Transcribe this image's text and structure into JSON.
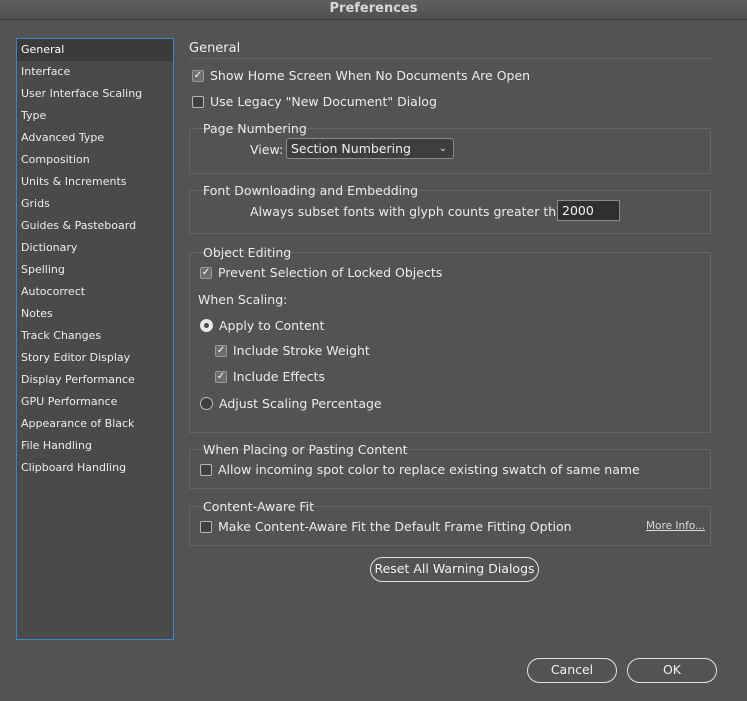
{
  "window": {
    "title": "Preferences"
  },
  "sidebar": {
    "items": [
      {
        "label": "General",
        "selected": true
      },
      {
        "label": "Interface"
      },
      {
        "label": "User Interface Scaling"
      },
      {
        "label": "Type"
      },
      {
        "label": "Advanced Type"
      },
      {
        "label": "Composition"
      },
      {
        "label": "Units & Increments"
      },
      {
        "label": "Grids"
      },
      {
        "label": "Guides & Pasteboard"
      },
      {
        "label": "Dictionary"
      },
      {
        "label": "Spelling"
      },
      {
        "label": "Autocorrect"
      },
      {
        "label": "Notes"
      },
      {
        "label": "Track Changes"
      },
      {
        "label": "Story Editor Display"
      },
      {
        "label": "Display Performance"
      },
      {
        "label": "GPU Performance"
      },
      {
        "label": "Appearance of Black"
      },
      {
        "label": "File Handling"
      },
      {
        "label": "Clipboard Handling"
      }
    ]
  },
  "main": {
    "title": "General",
    "show_home_screen": {
      "label": "Show Home Screen When No Documents Are Open",
      "checked": true
    },
    "legacy_new_doc": {
      "label": "Use Legacy \"New Document\" Dialog",
      "checked": false
    },
    "page_numbering": {
      "title": "Page Numbering",
      "view_label": "View:",
      "view_value": "Section Numbering"
    },
    "font_downloading": {
      "title": "Font Downloading and Embedding",
      "subset_label": "Always subset fonts with glyph counts greater than:",
      "subset_value": "2000"
    },
    "object_editing": {
      "title": "Object Editing",
      "prevent_locked": {
        "label": "Prevent Selection of Locked Objects",
        "checked": true
      },
      "when_scaling": "When Scaling:",
      "apply_to_content": {
        "label": "Apply to Content",
        "selected": true
      },
      "include_stroke": {
        "label": "Include Stroke Weight",
        "checked": true
      },
      "include_effects": {
        "label": "Include Effects",
        "checked": true
      },
      "adjust_percentage": {
        "label": "Adjust Scaling Percentage",
        "selected": false
      }
    },
    "placing": {
      "title": "When Placing or Pasting Content",
      "spot_color": {
        "label": "Allow incoming spot color to replace existing swatch of same name",
        "checked": false
      }
    },
    "content_aware": {
      "title": "Content-Aware Fit",
      "default_fit": {
        "label": "Make Content-Aware Fit the Default Frame Fitting Option",
        "checked": false
      },
      "more_info": "More Info..."
    },
    "reset_warnings": "Reset All Warning Dialogs"
  },
  "footer": {
    "cancel": "Cancel",
    "ok": "OK"
  },
  "colors": {
    "background": "#535353",
    "sidebar_border": "#3d83c8",
    "sidebar_selected": "#3b3b3b"
  },
  "icons": {
    "checkbox_checked": "checkmark-icon",
    "select": "chevron-down-icon"
  }
}
